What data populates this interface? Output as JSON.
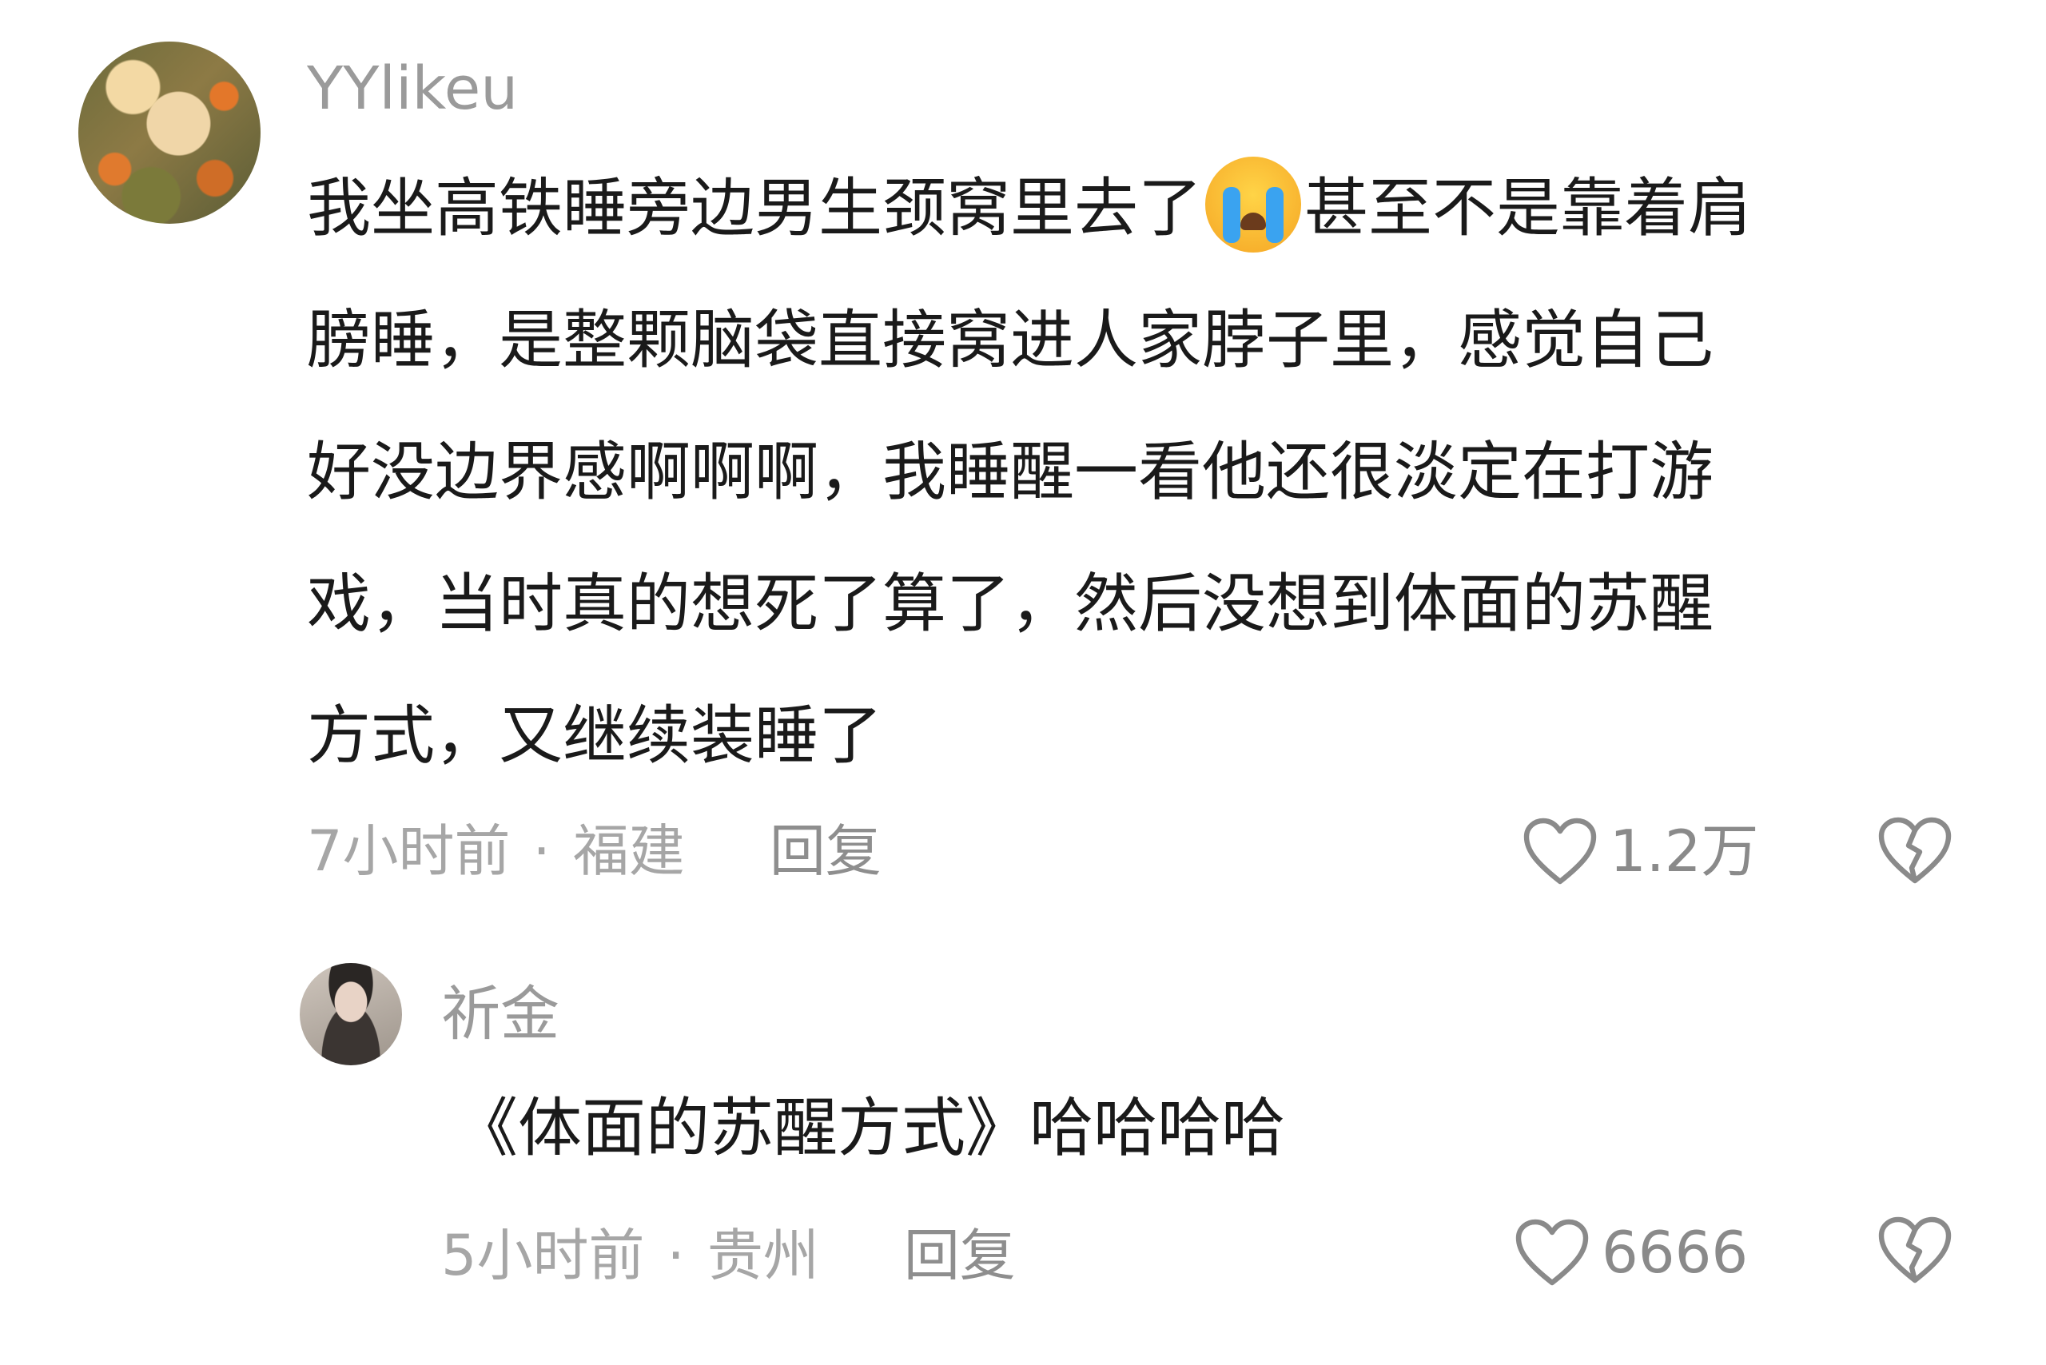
{
  "comment": {
    "username": "YYlikeu",
    "text_lines": [
      "我坐高铁睡旁边男生颈窝里去了",
      "甚至不是靠着肩",
      "膀睡，是整颗脑袋直接窝进人家脖子里，感觉自己",
      "好没边界感啊啊啊，我睡醒一看他还很淡定在打游",
      "戏，当时真的想死了算了，然后没想到体面的苏醒",
      "方式，又继续装睡了"
    ],
    "emoji": "crying-face",
    "time": "7小时前",
    "location": "福建",
    "reply_label": "回复",
    "likes": "1.2万"
  },
  "reply": {
    "username": "祈金",
    "text": "《体面的苏醒方式》哈哈哈哈",
    "time": "5小时前",
    "location": "贵州",
    "reply_label": "回复",
    "likes": "6666"
  },
  "separator": "·",
  "icons": {
    "like": "heart-outline-icon",
    "dislike": "broken-heart-icon"
  }
}
